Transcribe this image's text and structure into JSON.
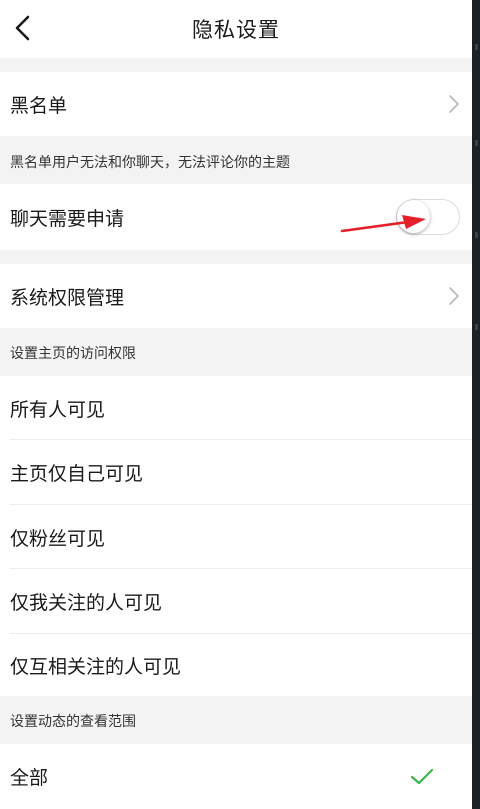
{
  "header": {
    "title": "隐私设置"
  },
  "blacklist": {
    "label": "黑名单",
    "caption": "黑名单用户无法和你聊天，无法评论你的主题"
  },
  "chat_request": {
    "label": "聊天需要申请",
    "enabled": false
  },
  "system_permissions": {
    "label": "系统权限管理"
  },
  "homepage_visibility": {
    "caption": "设置主页的访问权限",
    "options": [
      "所有人可见",
      "主页仅自己可见",
      "仅粉丝可见",
      "仅我关注的人可见",
      "仅互相关注的人可见"
    ]
  },
  "feed_visibility": {
    "caption": "设置动态的查看范围",
    "options": [
      "全部"
    ],
    "selected": "全部"
  },
  "colors": {
    "background": "#f3f3f3",
    "row": "#ffffff",
    "check": "#3cb44b",
    "annotation_arrow": "#e5202a"
  }
}
